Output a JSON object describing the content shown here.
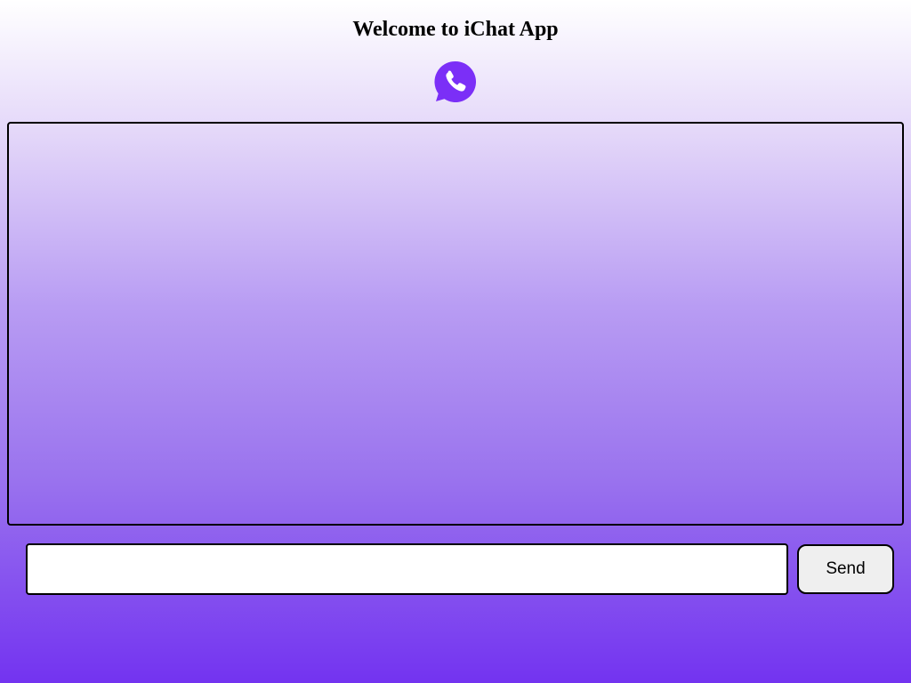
{
  "header": {
    "title": "Welcome to iChat App"
  },
  "logo": {
    "icon": "whatsapp-phone-icon",
    "color": "#7b2ff7"
  },
  "chat": {
    "messages": []
  },
  "composer": {
    "input_value": "",
    "placeholder": "",
    "send_label": "Send"
  },
  "theme": {
    "gradient_top": "#ffffff",
    "gradient_bottom": "#7333f0"
  }
}
